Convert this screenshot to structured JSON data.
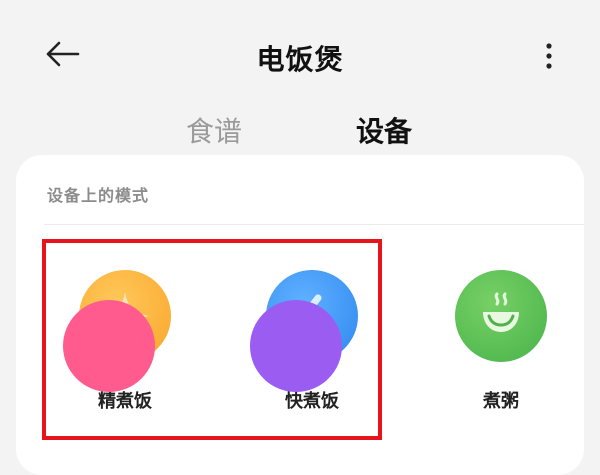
{
  "header": {
    "title": "电饭煲",
    "back_icon": "arrow-left-icon",
    "more_icon": "more-vertical-icon"
  },
  "tabs": [
    {
      "label": "食谱",
      "active": false
    },
    {
      "label": "设备",
      "active": true
    }
  ],
  "section": {
    "title": "设备上的模式"
  },
  "modes": [
    {
      "label": "精煮饭",
      "icon": "sparkle-icon",
      "color": "#f9a52a"
    },
    {
      "label": "快煮饭",
      "icon": "lightning-icon",
      "color": "#2d87ef"
    },
    {
      "label": "煮粥",
      "icon": "steaming-bowl-icon",
      "color": "#47b34a"
    }
  ],
  "colors": {
    "highlight": "#e8141b",
    "peek_pink": "#ff5b8f",
    "peek_purple": "#9b5cf2"
  }
}
